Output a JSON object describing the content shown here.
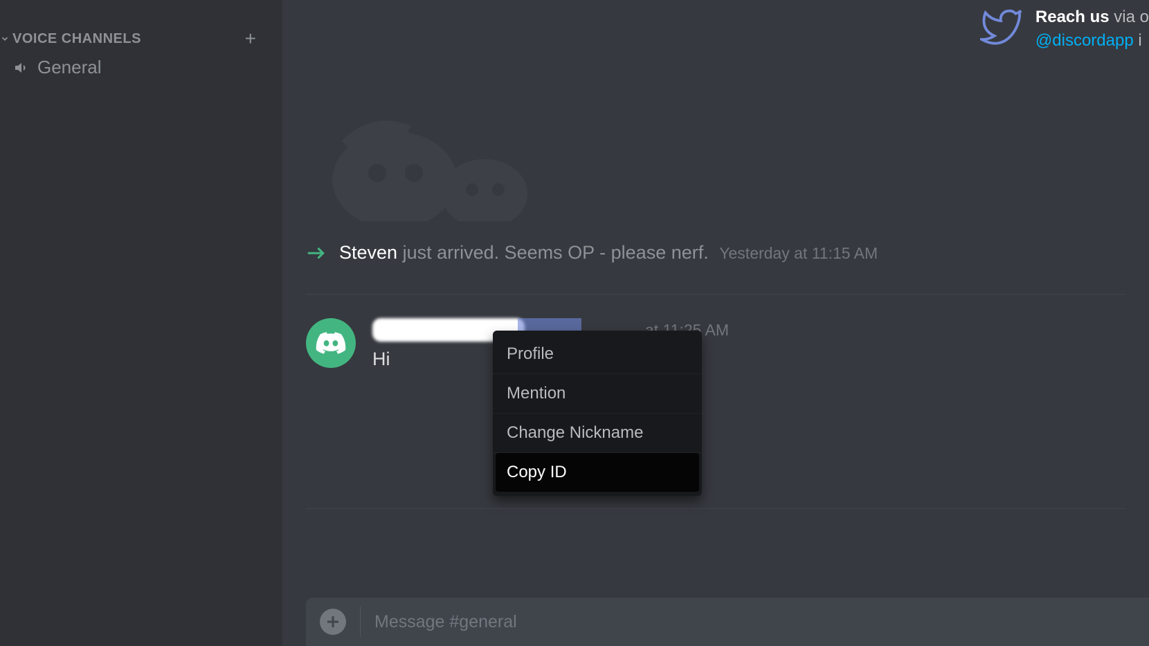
{
  "sidebar": {
    "section_label": "VOICE CHANNELS",
    "add_tooltip": "+",
    "channels": [
      {
        "name": "General"
      }
    ]
  },
  "header": {
    "reach_label": "Reach us",
    "via_label": "via o",
    "twitter_handle": "@discordapp",
    "tail": " i"
  },
  "system_message": {
    "user": "Steven",
    "text": " just arrived. Seems OP - please nerf.",
    "timestamp": "Yesterday at 11:15 AM"
  },
  "message": {
    "timestamp": "at 11:25 AM",
    "content": "Hi"
  },
  "context_menu": {
    "items": [
      {
        "label": "Profile",
        "hovered": false
      },
      {
        "label": "Mention",
        "hovered": false
      },
      {
        "label": "Change Nickname",
        "hovered": false
      },
      {
        "label": "Copy ID",
        "hovered": true
      }
    ]
  },
  "input": {
    "placeholder": "Message #general"
  }
}
